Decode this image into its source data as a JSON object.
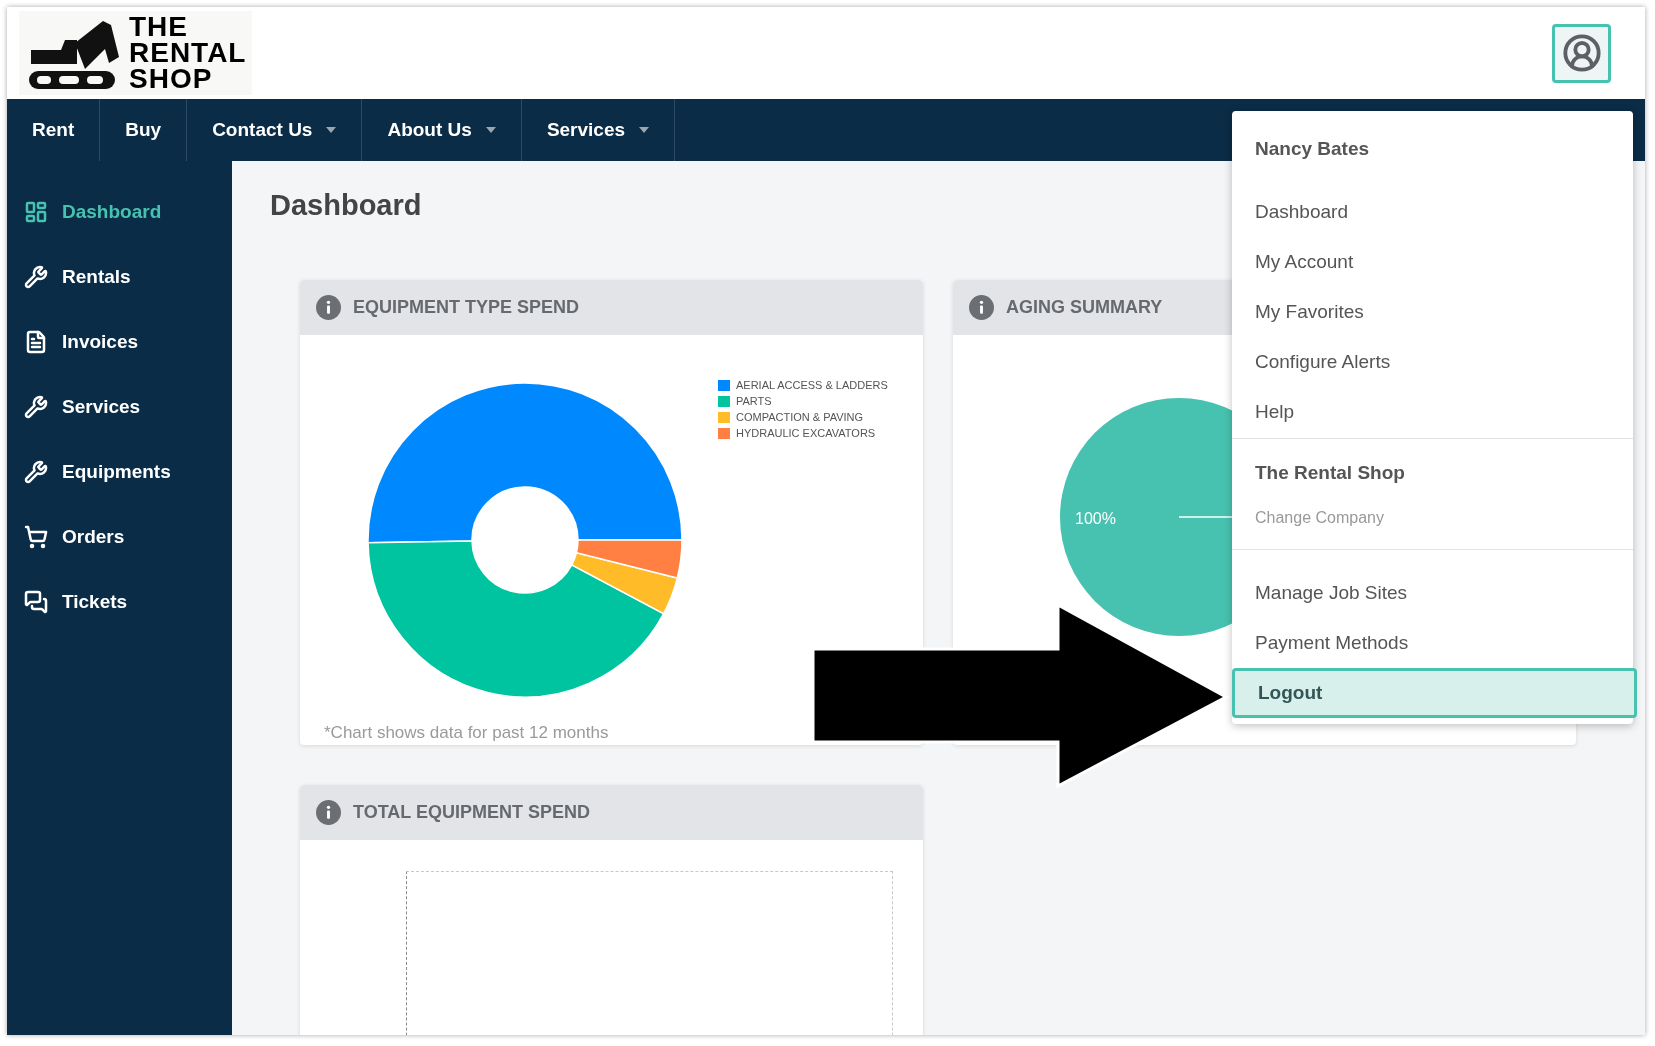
{
  "logo": {
    "lines": [
      "THE",
      "RENTAL",
      "SHOP"
    ]
  },
  "nav": [
    {
      "label": "Rent",
      "dropdown": false
    },
    {
      "label": "Buy",
      "dropdown": false
    },
    {
      "label": "Contact Us",
      "dropdown": true
    },
    {
      "label": "About Us",
      "dropdown": true
    },
    {
      "label": "Services",
      "dropdown": true
    }
  ],
  "sidebar": {
    "items": [
      {
        "label": "Dashboard",
        "selected": true
      },
      {
        "label": "Rentals",
        "selected": false
      },
      {
        "label": "Invoices",
        "selected": false
      },
      {
        "label": "Services",
        "selected": false
      },
      {
        "label": "Equipments",
        "selected": false
      },
      {
        "label": "Orders",
        "selected": false
      },
      {
        "label": "Tickets",
        "selected": false
      }
    ]
  },
  "page_title": "Dashboard",
  "cards": [
    {
      "title": "EQUIPMENT TYPE SPEND",
      "kind": "donut",
      "legend": [
        {
          "label": "AERIAL ACCESS & LADDERS",
          "color": "#0088fe"
        },
        {
          "label": "PARTS",
          "color": "#00c49f"
        },
        {
          "label": "COMPACTION & PAVING",
          "color": "#ffbb28"
        },
        {
          "label": "HYDRAULIC EXCAVATORS",
          "color": "#ff8042"
        }
      ],
      "footnote": "*Chart shows data for past 12 months"
    },
    {
      "title": "AGING SUMMARY",
      "kind": "pie",
      "slice_label": "100%"
    },
    {
      "title": "TOTAL EQUIPMENT SPEND",
      "kind": "empty"
    }
  ],
  "user_menu": {
    "user_name": "Nancy Bates",
    "sections": [
      {
        "items": [
          {
            "label": "Dashboard",
            "kind": "item",
            "selected": false
          },
          {
            "label": "My Account",
            "kind": "item",
            "selected": false
          },
          {
            "label": "My Favorites",
            "kind": "item",
            "selected": false
          },
          {
            "label": "Configure Alerts",
            "kind": "item",
            "selected": false
          },
          {
            "label": "Help",
            "kind": "item",
            "selected": false
          }
        ]
      },
      {
        "heading": "The Rental Shop",
        "items": [
          {
            "label": "Change Company",
            "kind": "subtle",
            "selected": false
          }
        ]
      },
      {
        "items": [
          {
            "label": "Manage Job Sites",
            "kind": "item",
            "selected": false
          },
          {
            "label": "Payment Methods",
            "kind": "item",
            "selected": false
          },
          {
            "label": "Logout",
            "kind": "item",
            "selected": true
          }
        ]
      }
    ]
  }
}
